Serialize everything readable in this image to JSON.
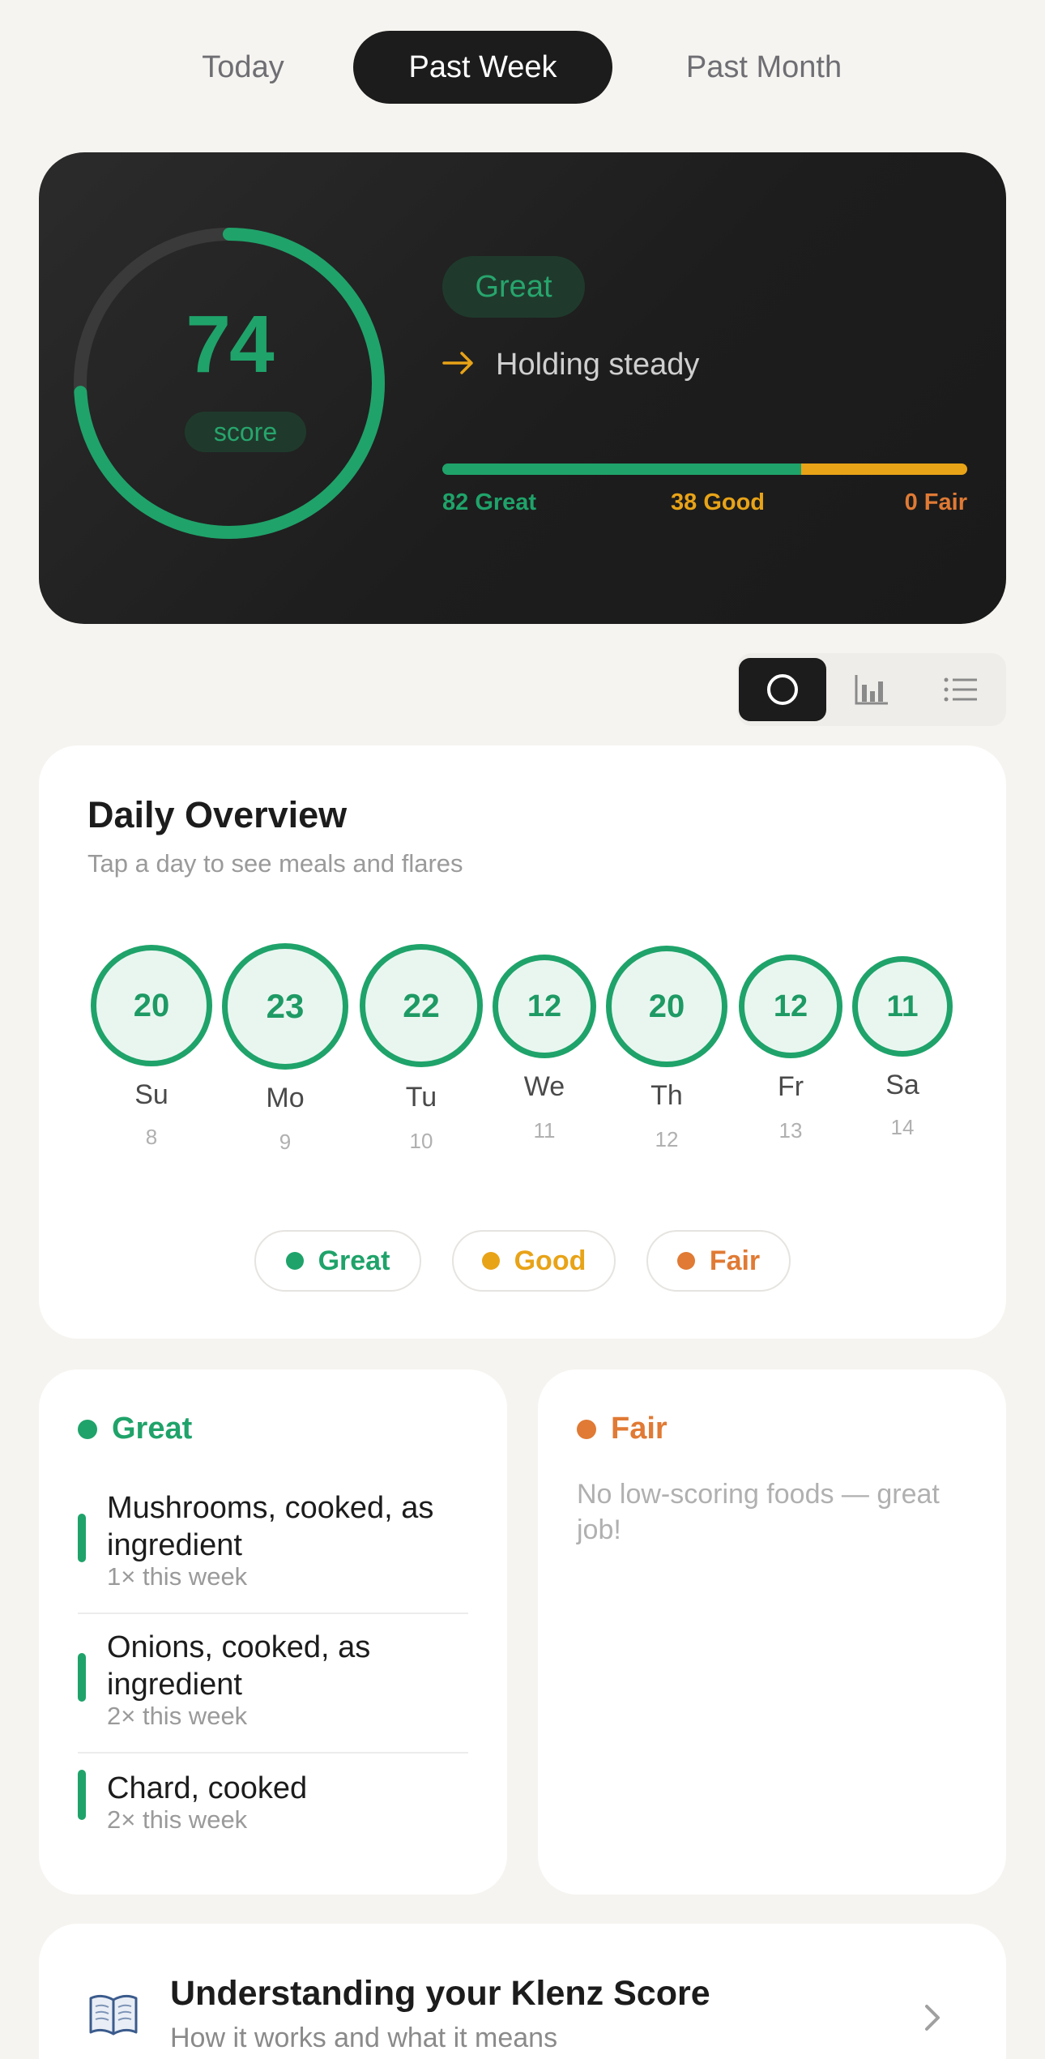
{
  "tabs": [
    {
      "label": "Today",
      "active": false
    },
    {
      "label": "Past Week",
      "active": true
    },
    {
      "label": "Past Month",
      "active": false
    }
  ],
  "score_card": {
    "score": "74",
    "score_label": "score",
    "score_fraction": 0.74,
    "status": "Great",
    "trend_icon": "arrow-right-icon",
    "trend_text": "Holding steady",
    "distribution": {
      "great": {
        "count": 82,
        "label": "82 Great"
      },
      "good": {
        "count": 38,
        "label": "38 Good"
      },
      "fair": {
        "count": 0,
        "label": "0 Fair"
      }
    }
  },
  "view_toggle": {
    "options": [
      {
        "icon": "circle-icon",
        "active": true
      },
      {
        "icon": "bar-chart-icon",
        "active": false
      },
      {
        "icon": "list-icon",
        "active": false
      }
    ]
  },
  "overview": {
    "title": "Daily Overview",
    "subtitle": "Tap a day to see meals and flares",
    "days": [
      {
        "score": "20",
        "day": "Su",
        "date": "8"
      },
      {
        "score": "23",
        "day": "Mo",
        "date": "9"
      },
      {
        "score": "22",
        "day": "Tu",
        "date": "10"
      },
      {
        "score": "12",
        "day": "We",
        "date": "11"
      },
      {
        "score": "20",
        "day": "Th",
        "date": "12"
      },
      {
        "score": "12",
        "day": "Fr",
        "date": "13"
      },
      {
        "score": "11",
        "day": "Sa",
        "date": "14"
      }
    ],
    "legend": [
      {
        "label": "Great",
        "color": "#1fa36a"
      },
      {
        "label": "Good",
        "color": "#e8a317"
      },
      {
        "label": "Fair",
        "color": "#e07a34"
      }
    ]
  },
  "great_foods": {
    "title": "Great",
    "items": [
      {
        "name": "Mushrooms, cooked, as ingredient",
        "count": "1× this week"
      },
      {
        "name": "Onions, cooked, as ingredient",
        "count": "2× this week"
      },
      {
        "name": "Chard, cooked",
        "count": "2× this week"
      }
    ]
  },
  "fair_foods": {
    "title": "Fair",
    "empty_text": "No low-scoring foods — great job!"
  },
  "info": {
    "icon": "book-icon",
    "title": "Understanding your Klenz Score",
    "subtitle": "How it works and what it means"
  },
  "colors": {
    "great": "#1fa36a",
    "good": "#e8a317",
    "fair": "#e07a34",
    "dark": "#1c1c1c"
  }
}
